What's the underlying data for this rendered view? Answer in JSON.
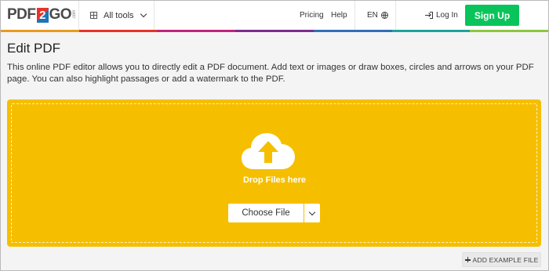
{
  "header": {
    "logo": {
      "part1": "PDF",
      "part2": "2",
      "part3": "GO",
      "suffix": ".com"
    },
    "all_tools_label": "All tools",
    "pricing_label": "Pricing",
    "help_label": "Help",
    "language_label": "EN",
    "login_label": "Log In",
    "signup_label": "Sign Up"
  },
  "colors": {
    "signup": "#09c45a",
    "dropzone": "#f5bf00",
    "rainbow": [
      "#e89a1f",
      "#e6332a",
      "#c0237c",
      "#7b2d8e",
      "#2f6fb7",
      "#1fa39a",
      "#8cc63f"
    ]
  },
  "page": {
    "title": "Edit PDF",
    "description": "This online PDF editor allows you to directly edit a PDF document. Add text or images or draw boxes, circles and arrows on your PDF page. You can also highlight passages or add a watermark to the PDF."
  },
  "upload": {
    "drop_label": "Drop Files here",
    "choose_file_label": "Choose File",
    "add_example_label": "ADD EXAMPLE FILE"
  }
}
